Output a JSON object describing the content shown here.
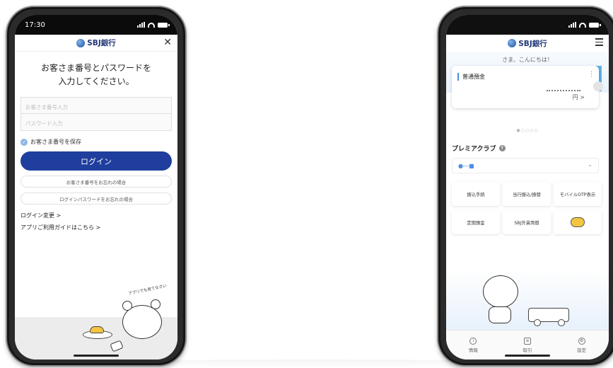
{
  "left_phone": {
    "status": {
      "time": "17:30"
    },
    "brand": "SBJ銀行",
    "close_icon": "close-icon",
    "title_line1": "お客さま番号とパスワードを",
    "title_line2": "入力してください。",
    "customer_number_placeholder": "お客さま番号入力",
    "password_placeholder": "パスワード入力",
    "save_label": "お客さま番号を保存",
    "login_button": "ログイン",
    "forgot_number": "お客さま番号をお忘れの場合",
    "forgot_password": "ログインパスワードをお忘れの場合",
    "login_change": "ログイン変更 >",
    "guide_link": "アプリご利用ガイドはこちら >",
    "bear_text": "アプリでも見てなさい"
  },
  "right_phone": {
    "brand": "SBJ銀行",
    "greeting": "さま、こんにちは！",
    "account_name": "普通預金",
    "currency": "円 >",
    "pager": "●○○○○",
    "club_title": "プレミアクラブ",
    "rank": "●―■",
    "menu": [
      {
        "label": "振込手続"
      },
      {
        "label": "当行振込/振替"
      },
      {
        "label": "モバイルOTP表示"
      },
      {
        "label": "定期預金"
      },
      {
        "label": "SBJ外貨両替"
      }
    ],
    "tabs": [
      {
        "label": "情報",
        "icon": "info-icon"
      },
      {
        "label": "取引",
        "icon": "document-icon"
      },
      {
        "label": "設定",
        "icon": "gear-icon"
      }
    ]
  },
  "colors": {
    "primary": "#1f3e9e",
    "accent": "#4a8fe0"
  }
}
